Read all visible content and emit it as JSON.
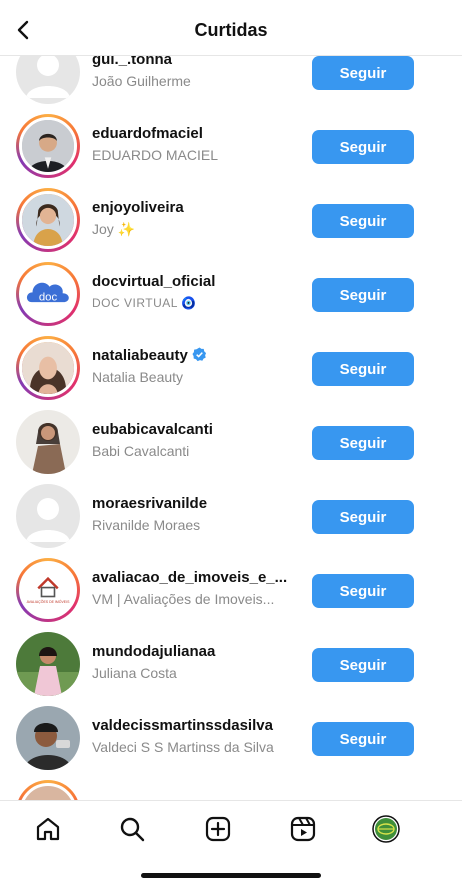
{
  "header": {
    "title": "Curtidas",
    "back_icon": "chevron-left-icon"
  },
  "colors": {
    "accent": "#3897f0",
    "muted_text": "#8a8a8a",
    "story_ring": "#e1306c"
  },
  "users": [
    {
      "username": "gui._.tonha",
      "fullname": "João Guilherme",
      "button": "Seguir"
    },
    {
      "username": "eduardofmaciel",
      "fullname": "EDUARDO MACIEL",
      "button": "Seguir"
    },
    {
      "username": "enjoyoliveira",
      "fullname": "Joy ✨",
      "button": "Seguir"
    },
    {
      "username": "docvirtual_oficial",
      "fullname": "DOC VIRTUAL 🧿",
      "button": "Seguir"
    },
    {
      "username": "nataliabeauty",
      "fullname": "Natalia Beauty",
      "button": "Seguir"
    },
    {
      "username": "eubabicavalcanti",
      "fullname": "Babi Cavalcanti",
      "button": "Seguir"
    },
    {
      "username": "moraesrivanilde",
      "fullname": "Rivanilde Moraes",
      "button": "Seguir"
    },
    {
      "username": "avaliacao_de_imoveis_e_...",
      "fullname": "VM | Avaliações de Imoveis...",
      "button": "Seguir"
    },
    {
      "username": "mundodajulianaa",
      "fullname": "Juliana Costa",
      "button": "Seguir"
    },
    {
      "username": "valdecissmartinssdasilva",
      "fullname": "Valdeci S S Martinss da Silva",
      "button": "Seguir"
    }
  ],
  "avatar_texts": {
    "doc": "doc",
    "imoveis": "AVALIAÇÕES DE IMÓVEIS"
  },
  "tabs": [
    {
      "icon": "home-icon"
    },
    {
      "icon": "search-icon"
    },
    {
      "icon": "new-post-icon"
    },
    {
      "icon": "reels-icon"
    },
    {
      "icon": "profile-avatar"
    }
  ]
}
